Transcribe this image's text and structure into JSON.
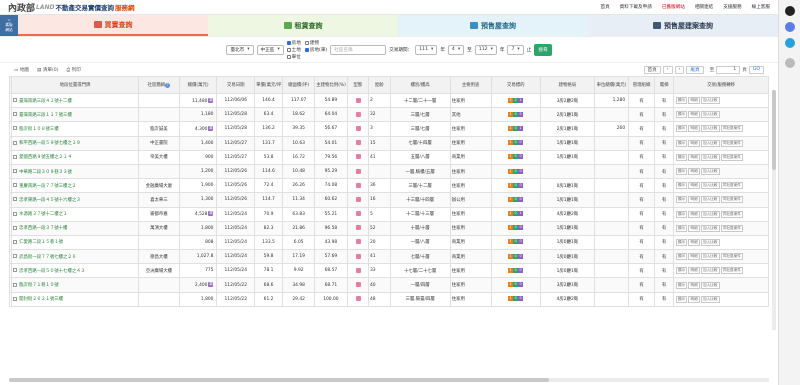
{
  "header": {
    "logo_main": "內政部",
    "logo_sub": "LAND",
    "title": "不動產交易實價查詢",
    "title_suffix": "服務網",
    "nav": [
      "首頁",
      "資料下載及申請",
      "已舊版網站",
      "相關連結",
      "支援服務",
      "線上客服"
    ]
  },
  "sidebar_button": [
    "三",
    "舊版",
    "網站"
  ],
  "tabs": [
    {
      "label": "買賣查詢",
      "icon_color": "#e2574c"
    },
    {
      "label": "租賃查詢",
      "icon_color": "#5da84c"
    },
    {
      "label": "預售屋查詢",
      "icon_color": "#3b8fc0"
    },
    {
      "label": "預售屋建案查詢",
      "icon_color": "#3f5878"
    }
  ],
  "search": {
    "city": "臺北市",
    "district": "中正區",
    "checkboxes": [
      {
        "label": "房地",
        "checked": true
      },
      {
        "label": "建物",
        "checked": false
      },
      {
        "label": "土地",
        "checked": false
      },
      {
        "label": "房地(車)",
        "checked": true
      },
      {
        "label": "車位",
        "checked": false
      }
    ],
    "community_placeholder": "社區名稱",
    "period_label": "交易期間：",
    "year_from": "111",
    "month_from": "4",
    "to_label": "至",
    "year_to": "112",
    "month_to": "7",
    "year_unit": "年",
    "month_unit": "月",
    "end_unit": "止",
    "search_button": "搜尋"
  },
  "toolbar": {
    "map": "地圖",
    "list": "清單(0)",
    "print": "列印",
    "first": "首頁",
    "prev": "‹",
    "next": "›",
    "last": "尾頁",
    "goto_label": "至",
    "page": "1",
    "page_unit": "頁",
    "go": "GO"
  },
  "table": {
    "headers": [
      "",
      "地段位置或門牌",
      "社區簡稱",
      "總價(萬元)",
      "交易日期",
      "單價(萬元/坪)",
      "總面積(坪)",
      "主建物比例(%)",
      "型態",
      "屋齡",
      "樓別/樓高",
      "主要用途",
      "交易標的",
      "建物格局",
      "車位總價(萬元)",
      "管理組織",
      "電梯",
      "交易/服務轉移"
    ],
    "row_buttons": [
      "顯示",
      "明細",
      "加入比較",
      "同社區案件"
    ],
    "rows": [
      {
        "addr": "臺灣南路三段４１號十二樓",
        "community": "",
        "total": "11,480",
        "tb": true,
        "date": "112/06/06",
        "unit": "146.4",
        "area": "117.07",
        "ratio": "54.89",
        "type_color": "#e57fa0",
        "age": "2",
        "floor": "十二層/二十一層",
        "use": "住家用",
        "tags": [
          "3",
          "2",
          "1"
        ],
        "layout": "3房2廳2衛",
        "park": "1,280",
        "mgmt": "有",
        "elev": "有",
        "same": false
      },
      {
        "addr": "臺灣南路三段１１７號三樓",
        "community": "",
        "total": "1,180",
        "tb": false,
        "date": "112/05/28",
        "unit": "63.4",
        "area": "18.62",
        "ratio": "64.04",
        "type_color": "#e57fa0",
        "age": "32",
        "floor": "三層/七層",
        "use": "其他",
        "tags": [
          "1",
          "0",
          "0"
        ],
        "layout": "2房1廳1衛",
        "park": "",
        "mgmt": "有",
        "elev": "有",
        "same": false
      },
      {
        "addr": "臨沂街１０８號三樓",
        "community": "臨沂誠美",
        "total": "4,300",
        "tb": true,
        "date": "112/05/28",
        "unit": "136.2",
        "area": "39.35",
        "ratio": "56.67",
        "type_color": "#e57fa0",
        "age": "3",
        "floor": "三層/七層",
        "use": "住家用",
        "tags": [
          "1",
          "0",
          "1"
        ],
        "layout": "2房1廳1衛",
        "park": "260",
        "mgmt": "有",
        "elev": "有",
        "same": true
      },
      {
        "addr": "和平西路一段５９號七樓之１９",
        "community": "中正書院",
        "total": "1,400",
        "tb": false,
        "date": "112/05/27",
        "unit": "131.7",
        "area": "10.63",
        "ratio": "54.01",
        "type_color": "#e57fa0",
        "age": "15",
        "floor": "七層/十四層",
        "use": "住家用",
        "tags": [
          "1",
          "0",
          "0"
        ],
        "layout": "1房1廳1衛",
        "park": "",
        "mgmt": "有",
        "elev": "有",
        "same": true
      },
      {
        "addr": "愛國西路９號五樓之２１４",
        "community": "帝美大樓",
        "total": "900",
        "tb": false,
        "date": "112/05/27",
        "unit": "53.8",
        "area": "16.72",
        "ratio": "79.56",
        "type_color": "#e57fa0",
        "age": "41",
        "floor": "五層/八層",
        "use": "商業用",
        "tags": [
          "1",
          "0",
          "0"
        ],
        "layout": "1房1廳1衛",
        "park": "",
        "mgmt": "有",
        "elev": "有",
        "same": true
      },
      {
        "addr": "中華路二段３０９巷３３號",
        "community": "",
        "total": "1,200",
        "tb": false,
        "date": "112/05/26",
        "unit": "114.6",
        "area": "10.48",
        "ratio": "95.29",
        "type_color": "#e57fa0",
        "age": "",
        "floor": "一層,騎樓/五層",
        "use": "住家用",
        "tags": [
          "1",
          "0",
          "0"
        ],
        "layout": "",
        "park": "",
        "mgmt": "有",
        "elev": "有",
        "same": false
      },
      {
        "addr": "重慶南路一段７７號三樓之２",
        "community": "金融廣場大廈",
        "total": "1,900",
        "tb": false,
        "date": "112/05/26",
        "unit": "72.4",
        "area": "26.26",
        "ratio": "74.08",
        "type_color": "#e57fa0",
        "age": "36",
        "floor": "三層/十二層",
        "use": "住家用",
        "tags": [
          "1",
          "0",
          "0"
        ],
        "layout": "0房1廳1衛",
        "park": "",
        "mgmt": "有",
        "elev": "有",
        "same": true
      },
      {
        "addr": "忠孝東路一段４５號十六樓之３",
        "community": "喜太華三",
        "total": "1,300",
        "tb": false,
        "date": "112/05/26",
        "unit": "114.7",
        "area": "11.34",
        "ratio": "60.62",
        "type_color": "#e57fa0",
        "age": "16",
        "floor": "十三層/十四層",
        "use": "辦公用",
        "tags": [
          "1",
          "0",
          "0"
        ],
        "layout": "1房1廳1衛",
        "park": "",
        "mgmt": "有",
        "elev": "有",
        "same": true
      },
      {
        "addr": "水源路３７號十二樓之１",
        "community": "崙都帝嘉",
        "total": "4,528",
        "tb": true,
        "date": "112/05/24",
        "unit": "70.9",
        "area": "63.83",
        "ratio": "55.21",
        "type_color": "#e57fa0",
        "age": "5",
        "floor": "十二層/十三層",
        "use": "住家用",
        "tags": [
          "1",
          "0",
          "1"
        ],
        "layout": "4房2廳2衛",
        "park": "",
        "mgmt": "有",
        "elev": "有",
        "same": true
      },
      {
        "addr": "忠孝西路一段３７號十樓",
        "community": "萬鴻大樓",
        "total": "1,800",
        "tb": false,
        "date": "112/05/24",
        "unit": "82.3",
        "area": "21.86",
        "ratio": "96.58",
        "type_color": "#e57fa0",
        "age": "52",
        "floor": "十層/十層",
        "use": "住家用",
        "tags": [
          "1",
          "0",
          "0"
        ],
        "layout": "1房1廳1衛",
        "park": "",
        "mgmt": "有",
        "elev": "有",
        "same": true
      },
      {
        "addr": "仁愛路二段１５巷１號",
        "community": "",
        "total": "808",
        "tb": false,
        "date": "112/05/24",
        "unit": "133.5",
        "area": "6.05",
        "ratio": "43.98",
        "type_color": "#e57fa0",
        "age": "20",
        "floor": "一層/八層",
        "use": "商業用",
        "tags": [
          "1",
          "0",
          "0"
        ],
        "layout": "1房0廳1衛",
        "park": "",
        "mgmt": "有",
        "elev": "有",
        "same": false
      },
      {
        "addr": "武昌街一段７７號七樓之２６",
        "community": "德昌大樓",
        "total": "1,027.8",
        "tb": false,
        "date": "112/05/24",
        "unit": "59.8",
        "area": "17.19",
        "ratio": "57.69",
        "type_color": "#e57fa0",
        "age": "41",
        "floor": "七層/十層",
        "use": "商業用",
        "tags": [
          "1",
          "0",
          "0"
        ],
        "layout": "1房0廳1衛",
        "park": "",
        "mgmt": "有",
        "elev": "有",
        "same": true
      },
      {
        "addr": "忠孝西路一段５０號十七樓之４３",
        "community": "亞洲廣場大樓",
        "total": "775",
        "tb": false,
        "date": "112/05/24",
        "unit": "78.1",
        "area": "9.92",
        "ratio": "68.57",
        "type_color": "#e57fa0",
        "age": "33",
        "floor": "十七層/二十七層",
        "use": "住家用",
        "tags": [
          "1",
          "0",
          "0"
        ],
        "layout": "1房0廳1衛",
        "park": "",
        "mgmt": "有",
        "elev": "有",
        "same": true
      },
      {
        "addr": "臨沂街７１巷１０號",
        "community": "",
        "total": "2,400",
        "tb": true,
        "date": "112/05/22",
        "unit": "68.6",
        "area": "34.98",
        "ratio": "68.71",
        "type_color": "#e57fa0",
        "age": "40",
        "floor": "一層/四層",
        "use": "住家用",
        "tags": [
          "1",
          "0",
          "0"
        ],
        "layout": "3房2廳1衛",
        "park": "",
        "mgmt": "有",
        "elev": "有",
        "same": false
      },
      {
        "addr": "開封街２６２１號三樓",
        "community": "",
        "total": "1,800",
        "tb": false,
        "date": "112/05/22",
        "unit": "61.2",
        "area": "29.42",
        "ratio": "100.00",
        "type_color": "#e57fa0",
        "age": "48",
        "floor": "三層,陽臺/四層",
        "use": "住家用",
        "tags": [
          "1",
          "0",
          "0"
        ],
        "layout": "4房2廳2衛",
        "park": "",
        "mgmt": "有",
        "elev": "有",
        "same": false
      }
    ]
  },
  "colors": {
    "tag1": "#e67e22",
    "tag2": "#2ea36a",
    "tag3": "#8e5fc2",
    "accent": "#2a6fd6"
  }
}
